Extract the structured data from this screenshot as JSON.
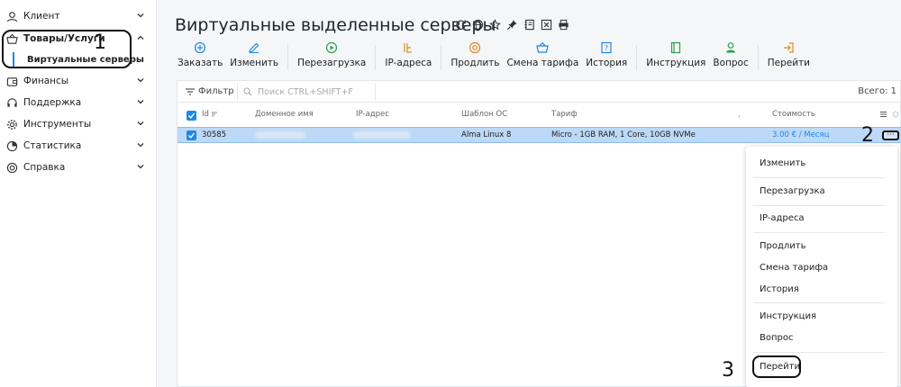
{
  "sidebar": {
    "items": [
      {
        "label": "Клиент",
        "icon": "user-icon"
      },
      {
        "label": "Товары/Услуги",
        "icon": "basket-icon"
      },
      {
        "label": "Финансы",
        "icon": "wallet-icon"
      },
      {
        "label": "Поддержка",
        "icon": "headset-icon"
      },
      {
        "label": "Инструменты",
        "icon": "gear-icon"
      },
      {
        "label": "Статистика",
        "icon": "pie-chart-icon"
      },
      {
        "label": "Справка",
        "icon": "lifebuoy-icon"
      }
    ],
    "subitem": "Виртуальные серверы"
  },
  "annotations": {
    "one": "1",
    "two": "2",
    "three": "3"
  },
  "page": {
    "title": "Виртуальные выделенные серверы",
    "title_icons": [
      "refresh-icon",
      "globe-icon",
      "star-icon",
      "pin-icon",
      "notebook-icon",
      "export-icon",
      "print-icon"
    ]
  },
  "toolbar": {
    "buttons": [
      {
        "label": "Заказать",
        "icon": "plus-circle-icon"
      },
      {
        "label": "Изменить",
        "icon": "pencil-icon"
      },
      {
        "label": "Перезагрузка",
        "icon": "play-circle-icon"
      },
      {
        "label": "IP-адреса",
        "icon": "ip-icon"
      },
      {
        "label": "Продлить",
        "icon": "lifebuoy-icon"
      },
      {
        "label": "Смена тарифа",
        "icon": "basket-icon"
      },
      {
        "label": "История",
        "icon": "question-box-icon"
      },
      {
        "label": "Инструкция",
        "icon": "book-icon"
      },
      {
        "label": "Вопрос",
        "icon": "person-question-icon"
      },
      {
        "label": "Перейти",
        "icon": "enter-icon"
      }
    ]
  },
  "table": {
    "filter_label": "Фильтр",
    "search_placeholder": "Поиск CTRL+SHIFT+F",
    "total": "Всего: 1",
    "columns": [
      "Id",
      "Доменное имя",
      "IP-адрес",
      "Шаблон ОС",
      "Тариф",
      "Стоимость"
    ],
    "rows": [
      {
        "id": "30585",
        "domain": "",
        "ip": "",
        "os": "Alma Linux 8",
        "tariff": "Micro - 1GB RAM, 1 Core, 10GB NVMe",
        "price": "3.00 € / Месяц",
        "more": "···"
      }
    ]
  },
  "context_menu": {
    "items": [
      "Изменить",
      "Перезагрузка",
      "IP-адреса",
      "Продлить",
      "Смена тарифа",
      "История",
      "Инструкция",
      "Вопрос",
      "Перейти"
    ]
  },
  "colors": {
    "accent": "#1e88e5",
    "selected_row": "#bcd9f7",
    "icon_green": "#2e9e4f",
    "icon_orange": "#e08a1e"
  }
}
